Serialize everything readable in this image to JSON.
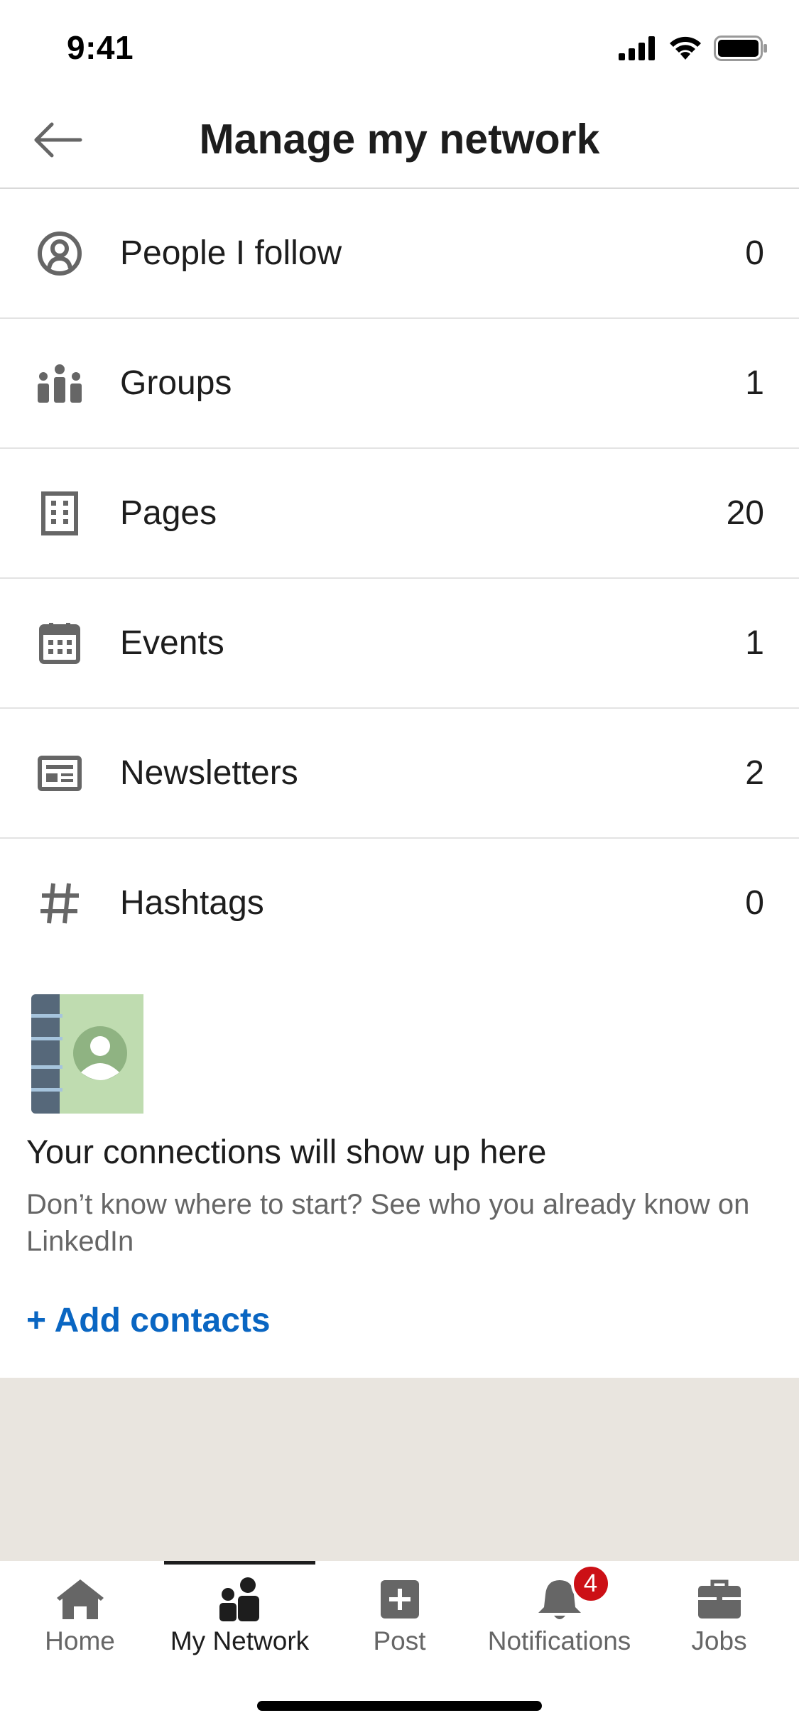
{
  "status_bar": {
    "time": "9:41"
  },
  "header": {
    "title": "Manage my network",
    "back_icon": "arrow-left-icon"
  },
  "list": [
    {
      "label": "People I follow",
      "count": "0",
      "icon": "person-follow-icon"
    },
    {
      "label": "Groups",
      "count": "1",
      "icon": "groups-icon"
    },
    {
      "label": "Pages",
      "count": "20",
      "icon": "building-icon"
    },
    {
      "label": "Events",
      "count": "1",
      "icon": "calendar-icon"
    },
    {
      "label": "Newsletters",
      "count": "2",
      "icon": "newsletter-icon"
    },
    {
      "label": "Hashtags",
      "count": "0",
      "icon": "hashtag-icon"
    }
  ],
  "connections_card": {
    "title": "Your connections will show up here",
    "description": "Don’t know where to start? See who you already know on LinkedIn",
    "add_contacts_label": "+ Add contacts"
  },
  "bottom_nav": {
    "items": [
      {
        "label": "Home",
        "icon": "home-icon"
      },
      {
        "label": "My Network",
        "icon": "my-network-icon",
        "active": true
      },
      {
        "label": "Post",
        "icon": "post-icon"
      },
      {
        "label": "Notifications",
        "icon": "bell-icon",
        "badge": "4"
      },
      {
        "label": "Jobs",
        "icon": "briefcase-icon"
      }
    ]
  },
  "colors": {
    "accent": "#0a66c2",
    "badge": "#cc1016",
    "icon_gray": "#666666",
    "background_gray": "#e9e5df"
  }
}
